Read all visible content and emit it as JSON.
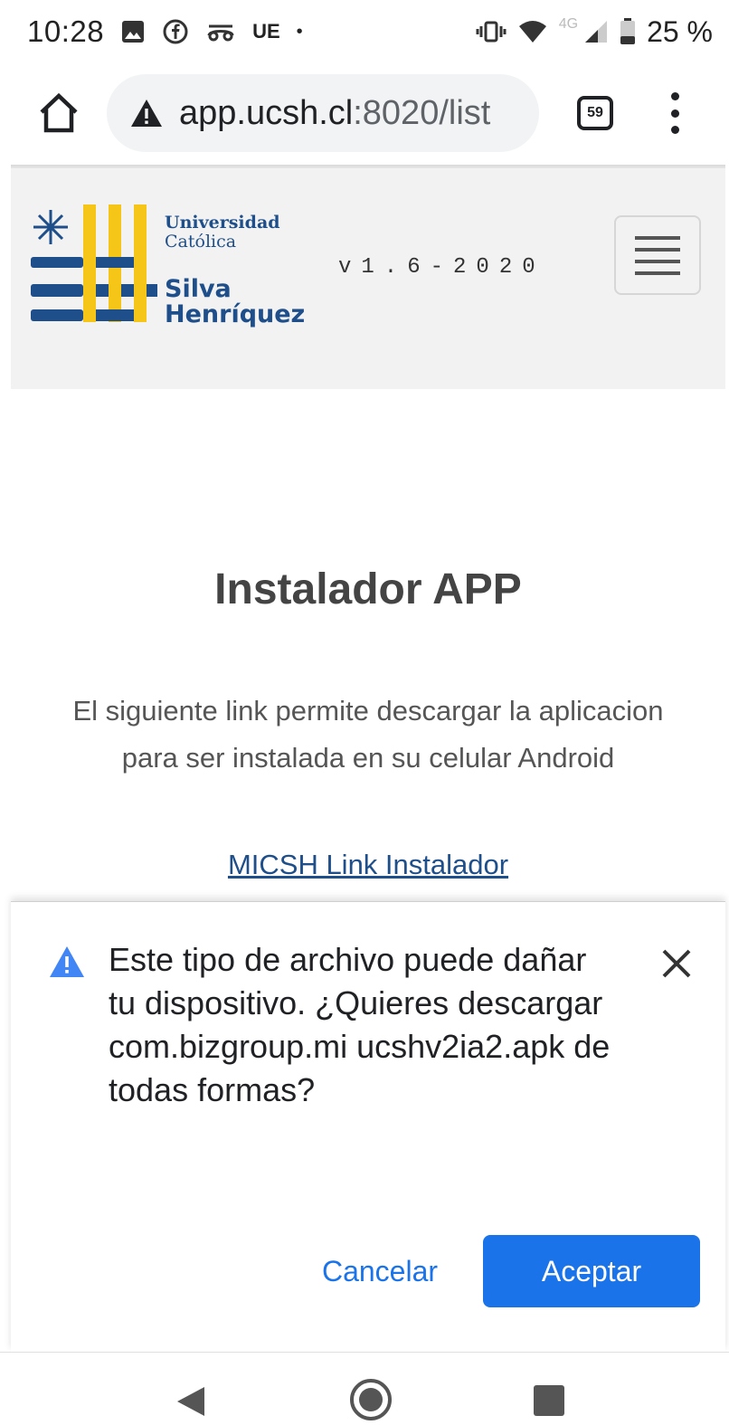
{
  "status_bar": {
    "time": "10:28",
    "carrier": "UE",
    "dot": "•",
    "network": "4G",
    "battery": "25 %"
  },
  "browser": {
    "url_host": "app.ucsh.cl",
    "url_path": ":8020/list",
    "tab_count": "59"
  },
  "header": {
    "logo_line1": "Universidad",
    "logo_line2": "Católica",
    "logo_line3": "Silva",
    "logo_line4": "Henríquez",
    "version": "v1.6-2020"
  },
  "main": {
    "title": "Instalador APP",
    "description": "El siguiente link permite descargar la aplicacion para ser instalada en su celular Android",
    "link_label": "MICSH Link Instalador"
  },
  "download_sheet": {
    "message": "Este tipo de archivo puede dañar tu dispositivo. ¿Quieres descargar com.bizgroup.mi ucshv2ia2.apk de todas formas?",
    "cancel_label": "Cancelar",
    "accept_label": "Aceptar"
  },
  "colors": {
    "accent": "#1a73e8",
    "brand_blue": "#1f4f8a",
    "brand_yellow": "#f5c518"
  }
}
